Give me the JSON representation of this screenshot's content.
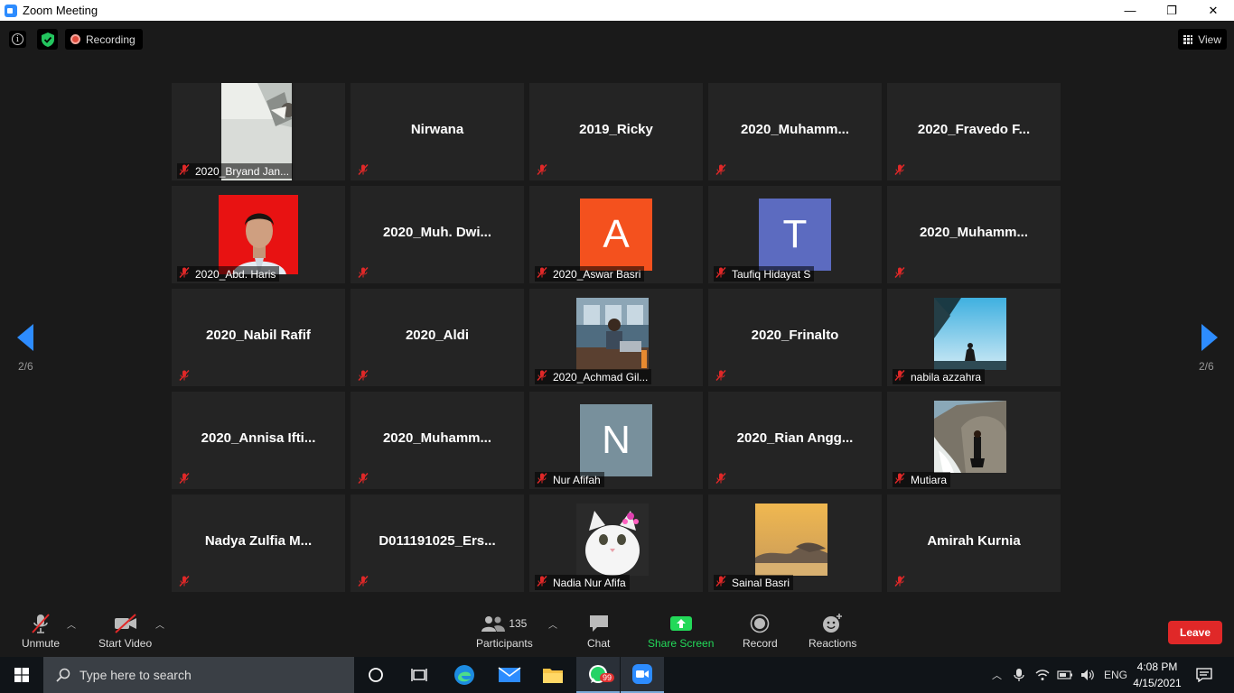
{
  "window": {
    "title": "Zoom Meeting",
    "minimize": "—",
    "maximize": "❐",
    "close": "✕"
  },
  "topbar": {
    "recording": "Recording",
    "view": "View"
  },
  "pager": {
    "left_label": "2/6",
    "right_label": "2/6"
  },
  "tiles": [
    {
      "name": "2020_Bryand Jan...",
      "kind": "photo",
      "photo": "bryand"
    },
    {
      "name": "Nirwana",
      "kind": "name"
    },
    {
      "name": "2019_Ricky",
      "kind": "name"
    },
    {
      "name": "2020_Muhamm...",
      "kind": "name"
    },
    {
      "name": "2020_Fravedo F...",
      "kind": "name"
    },
    {
      "name": "2020_Abd. Haris",
      "kind": "photo",
      "photo": "haris"
    },
    {
      "name": "2020_Muh. Dwi...",
      "kind": "name"
    },
    {
      "name": "2020_Aswar Basri",
      "kind": "avatar",
      "letter": "A",
      "color": "#f4511e"
    },
    {
      "name": "Taufiq Hidayat S",
      "kind": "avatar",
      "letter": "T",
      "color": "#5c6bc0"
    },
    {
      "name": "2020_Muhamm...",
      "kind": "name"
    },
    {
      "name": "2020_Nabil Rafif",
      "kind": "name"
    },
    {
      "name": "2020_Aldi",
      "kind": "name"
    },
    {
      "name": "2020_Achmad Gil...",
      "kind": "photo",
      "photo": "achmad"
    },
    {
      "name": "2020_Frinalto",
      "kind": "name"
    },
    {
      "name": "nabila azzahra",
      "kind": "photo",
      "photo": "nabila"
    },
    {
      "name": "2020_Annisa Ifti...",
      "kind": "name"
    },
    {
      "name": "2020_Muhamm...",
      "kind": "name"
    },
    {
      "name": "Nur Afifah",
      "kind": "avatar",
      "letter": "N",
      "color": "#78909c"
    },
    {
      "name": "2020_Rian Angg...",
      "kind": "name"
    },
    {
      "name": "Mutiara",
      "kind": "photo",
      "photo": "mutiara"
    },
    {
      "name": "Nadya Zulfia M...",
      "kind": "name"
    },
    {
      "name": "D011191025_Ers...",
      "kind": "name"
    },
    {
      "name": "Nadia Nur Afifa",
      "kind": "photo",
      "photo": "cat"
    },
    {
      "name": "Sainal Basri",
      "kind": "photo",
      "photo": "sunset"
    },
    {
      "name": "Amirah Kurnia",
      "kind": "name"
    }
  ],
  "toolbar": {
    "unmute": "Unmute",
    "start_video": "Start Video",
    "participants": "Participants",
    "participant_count": "135",
    "chat": "Chat",
    "share_screen": "Share Screen",
    "record": "Record",
    "reactions": "Reactions",
    "leave": "Leave"
  },
  "taskbar": {
    "search_placeholder": "Type here to search",
    "whatsapp_badge": "99",
    "language": "ENG",
    "time": "4:08 PM",
    "date": "4/15/2021"
  },
  "colors": {
    "share_green": "#23d959",
    "leave_red": "#e02828",
    "arrow_blue": "#2d8cff"
  }
}
